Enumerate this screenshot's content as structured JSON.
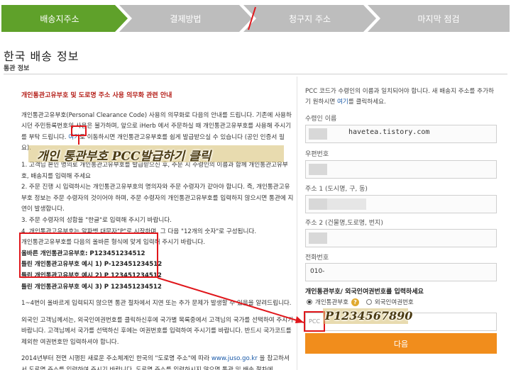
{
  "steps": [
    "배송지주소",
    "결제방법",
    "청구지 주소",
    "마지막 점검"
  ],
  "page": {
    "title": "한국 배송 정보",
    "subtitle": "통관 정보"
  },
  "notice": {
    "heading": "개인통관고유부호 및 도로명 주소 사용 의무화 관련 안내",
    "p1a": "개인통관고유부호(Personal Clearance Code) 사용의 의무화로 다음의 안내를 드립니다. 기존에 사용하시던 주민등록번호의 사용은 불가하며, 앞으로 iHerb 에서 주문하실 때 개인통관고유부호를 사용해 주시기를 부탁 드립니다.",
    "p1_link": "여기",
    "p1b": "로 이동하시면 개인통관고유부호를 쉽게 발급받으실 수 있습니다 (공인 인증서 필요).",
    "i1": "1. 고객님 본인 명의로 개인통관고유부호를 발급받으신 후, 주문 시 수령인의 이름과 함께 개인통관고유부호, 배송지를 입력해 주세요",
    "i2": "2. 주문 진행 시 입력하시는 개인통관고유부호의 명의자와 주문 수령자가 같아야 합니다. 즉, 개인통관고유부호 정보는 주문 수령자의 것이어야 하며, 주문 수령자의 개인통관고유부호를 입력하지 않으시면 통관에 지연이 발생합니다.",
    "i3": "3. 주문 수령자의 성함을 \"한글\"로 입력해 주시기 바랍니다.",
    "i4": "4. 개인통관고유부호는 알파벳 대문자\"P\"로 시작하며, 그 다음 \"12개의 숫자\"로 구성됩니다.",
    "i5": "개인통관고유부호를 다음의 올바른 형식에 맞게 입력해 주시기 바랍니다.",
    "ex_correct": "올바른 개인통관고유부호: P123451234512",
    "ex_wrong1": "틀린 개인통관고유부호 예시 1) P-123451234512",
    "ex_wrong2": "틀린 개인통관고유부호 예시 2) P 123451234512",
    "ex_wrong3": "틀린 개인통관고유부호 예시 3) P 123451234512",
    "p_delay": "1~4번이 올바르게 입력되지 않으면 통관 절차에서 지연 또는 추가 문제가 발생할 수 있음을 알려드립니다.",
    "p_foreign": "외국인 고객님께서는, 외국인여권번호를 클릭하신후에 국가별 목록중에서 고객님의 국가를 선택하여 주시기 바랍니다. 고객님께서 국가를 선택하신 후에는 여권번호를 입력하여 주시기를 바랍니다. 반드시 국가코드를 제외한 여권번호만 입력하셔야 합니다.",
    "p_road_a": "2014년부터 전면 시행된 새로운 주소체계인 한국의 \"도로명 주소\"에 따라 ",
    "p_road_link": "www.juso.go.kr",
    "p_road_b": " 을 참고하셔서 도로명 주소를 입력하여 주시기 바랍니다. 도로명 주소를 입력하시지 않으면 통관 및 배송 절차에"
  },
  "form": {
    "intro_a": "PCC 코드가 수령인의 이름과 일치되어야 합니다. 새 배송지 주소를 추가하기 원하시면 ",
    "intro_link": "여기",
    "intro_b": "를 클릭하세요.",
    "name_label": "수령인 이름",
    "zip_label": "우편번호",
    "addr1_label": "주소 1 (도시명, 구, 동)",
    "addr2_label": "주소 2 (건물명,도로명, 번지)",
    "phone_label": "전화번호",
    "phone_value": "010-",
    "watermark": "havetea.tistory.com",
    "id_label": "개인통관부호/ 외국인여권번호를 입력하세요",
    "radio_pcc": "개인통관부호",
    "radio_passport": "외국인여권번호",
    "pcc_placeholder": "PCC",
    "next_label": "다음"
  },
  "annotations": {
    "link_callout": "개인 통관부호 PCC발급하기 클릭",
    "pcc_example": "P1234567890"
  }
}
